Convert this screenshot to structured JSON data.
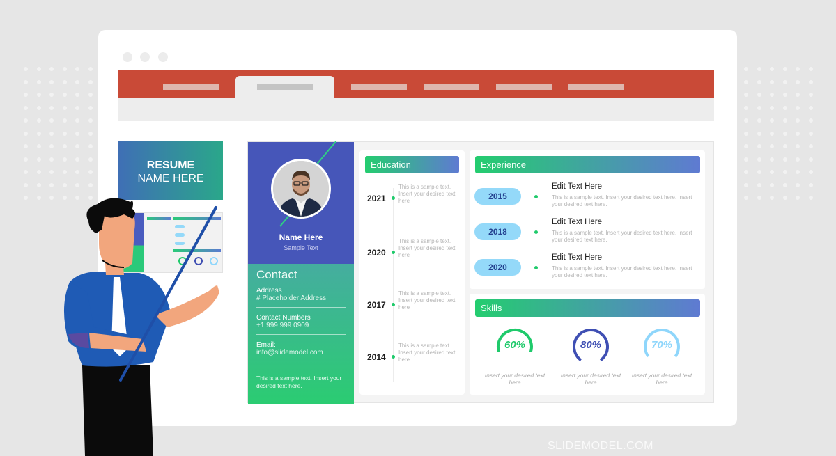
{
  "window": {
    "traffic_lights": [
      "dot",
      "dot",
      "dot"
    ],
    "ribbon_tabs": [
      {
        "label": "",
        "active": false
      },
      {
        "label": "",
        "active": true
      },
      {
        "label": "",
        "active": false
      },
      {
        "label": "",
        "active": false
      },
      {
        "label": "",
        "active": false
      },
      {
        "label": "",
        "active": false
      }
    ],
    "ribbon_color": "#c94a37"
  },
  "thumbnails": {
    "title_slide": {
      "line1": "RESUME",
      "line2": "NAME HERE"
    }
  },
  "resume": {
    "profile": {
      "name": "Name Here",
      "subtitle": "Sample Text",
      "photo": "profile-photo"
    },
    "contact": {
      "heading": "Contact",
      "address_label": "Address",
      "address_value": "# Placeholder Address",
      "phone_label": "Contact Numbers",
      "phone_value": "+1 999 999 0909",
      "email_label": "Email:",
      "email_value": "info@slidemodel.com",
      "note": "This is a sample text. Insert your desired text here."
    },
    "education": {
      "heading": "Education",
      "items": [
        {
          "year": "2021",
          "text": "This is a sample text. Insert your desired text here"
        },
        {
          "year": "2020",
          "text": "This is a sample text. Insert your desired text here"
        },
        {
          "year": "2017",
          "text": "This is a sample text. Insert your desired text here"
        },
        {
          "year": "2014",
          "text": "This is a sample text. Insert your desired text here"
        }
      ]
    },
    "experience": {
      "heading": "Experience",
      "items": [
        {
          "year": "2015",
          "title": "Edit Text Here",
          "desc": "This is a sample text. Insert your desired text here. Insert your desired text here."
        },
        {
          "year": "2018",
          "title": "Edit Text Here",
          "desc": "This is a sample text. Insert your desired text here. Insert your desired text here."
        },
        {
          "year": "2020",
          "title": "Edit Text Here",
          "desc": "This is a sample text. Insert your desired text here. Insert your desired text here."
        }
      ]
    },
    "skills": {
      "heading": "Skills",
      "items": [
        {
          "percent_label": "60%",
          "value": 60,
          "color": "#1fca6b",
          "caption": "Insert your desired text here"
        },
        {
          "percent_label": "80%",
          "value": 80,
          "color": "#3f4fb3",
          "caption": "Insert your desired text here"
        },
        {
          "percent_label": "70%",
          "value": 70,
          "color": "#8fd6fb",
          "caption": "Insert your desired text here"
        }
      ]
    },
    "colors": {
      "sidebar_top": "#4656b9",
      "accent_green": "#24cd6f",
      "accent_blue": "#5f7ad2",
      "pill": "#94d9f9"
    }
  },
  "branding": {
    "watermark": "SLIDEMODEL.COM"
  }
}
